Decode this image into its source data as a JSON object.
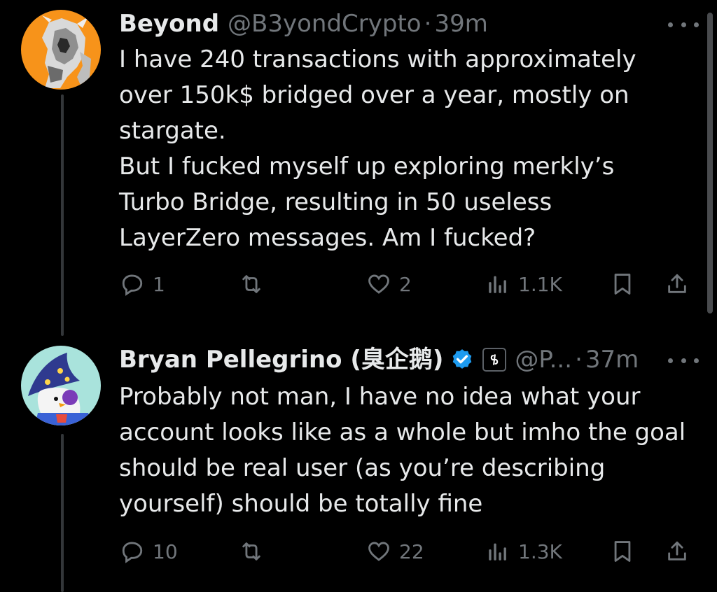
{
  "tweets": [
    {
      "name": "Beyond",
      "handle": "@B3yondCrypto",
      "separator": "·",
      "time": "39m",
      "text_lines": [
        "I have 240 transactions with approximately over 150k$ bridged over a year, mostly on stargate.",
        "But I fucked myself up exploring merkly’s Turbo Bridge, resulting in 50 useless LayerZero messages. Am I fucked?"
      ],
      "replies": "1",
      "reposts": "",
      "likes": "2",
      "views": "1.1K",
      "avatar_color": "#f7931a",
      "avatar_icon": "dragon-knight-icon"
    },
    {
      "name": "Bryan Pellegrino (臭企鹅)",
      "handle": "@P...",
      "separator": "·",
      "time": "37m",
      "text_lines": [
        "Probably not man, I have no idea what your account looks like as a whole but imho the goal should be real user (as you’re describing yourself) should be totally fine"
      ],
      "replies": "10",
      "reposts": "",
      "likes": "22",
      "views": "1.3K",
      "avatar_color": "#a9e3dc",
      "avatar_icon": "wizard-penguin-icon",
      "verified_color": "#1d9bf0",
      "affiliate_badge_icon": "layerzero-icon"
    }
  ],
  "colors": {
    "background": "#000000",
    "text_primary": "#e7e9ea",
    "text_secondary": "#71767b"
  }
}
